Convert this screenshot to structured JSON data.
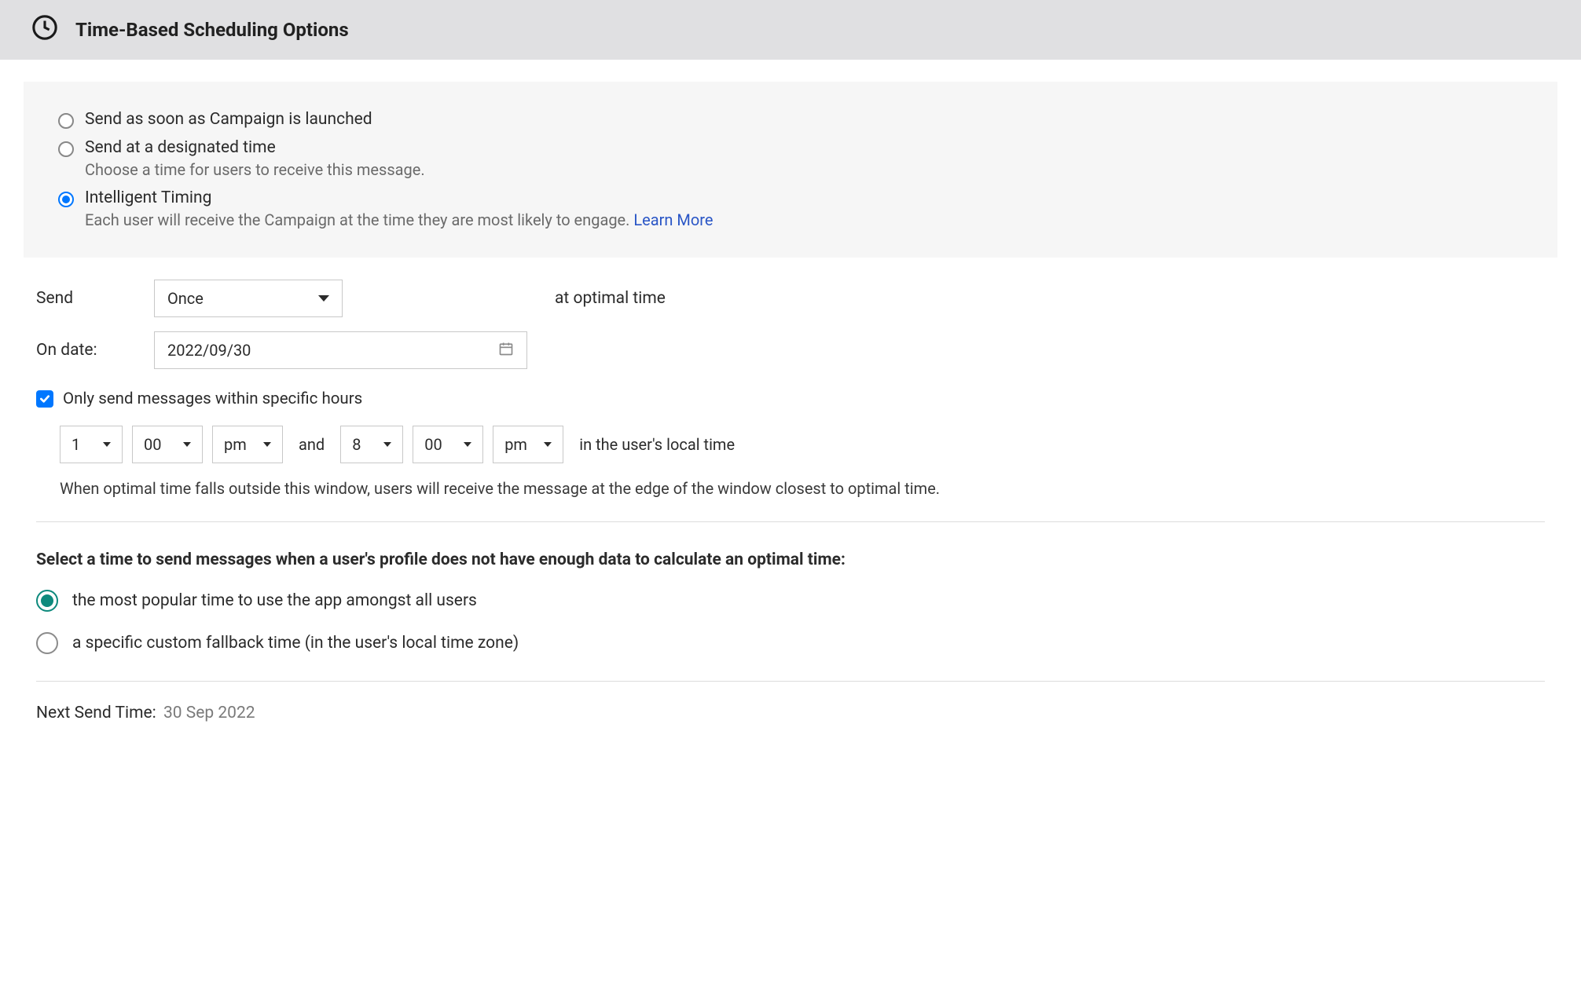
{
  "header": {
    "title": "Time-Based Scheduling Options"
  },
  "scheduling_options": {
    "option1": {
      "label": "Send as soon as Campaign is launched"
    },
    "option2": {
      "label": "Send at a designated time",
      "desc": "Choose a time for users to receive this message."
    },
    "option3": {
      "label": "Intelligent Timing",
      "desc_prefix": "Each user will receive the Campaign at the time they are most likely to engage. ",
      "learn_more": "Learn More"
    }
  },
  "send": {
    "label": "Send",
    "frequency": "Once",
    "suffix": "at optimal time"
  },
  "on_date": {
    "label": "On date:",
    "value": "2022/09/30"
  },
  "specific_hours": {
    "checkbox_label": "Only send messages within specific hours",
    "start_hour": "1",
    "start_min": "00",
    "start_ampm": "pm",
    "and": "and",
    "end_hour": "8",
    "end_min": "00",
    "end_ampm": "pm",
    "tz_text": "in the user's local time",
    "help": "When optimal time falls outside this window, users will receive the message at the edge of the window closest to optimal time."
  },
  "fallback": {
    "heading": "Select a time to send messages when a user's profile does not have enough data to calculate an optimal time:",
    "opt1": "the most popular time to use the app amongst all users",
    "opt2": "a specific custom fallback time (in the user's local time zone)"
  },
  "next_send": {
    "label": "Next Send Time:",
    "value": "30 Sep 2022"
  }
}
